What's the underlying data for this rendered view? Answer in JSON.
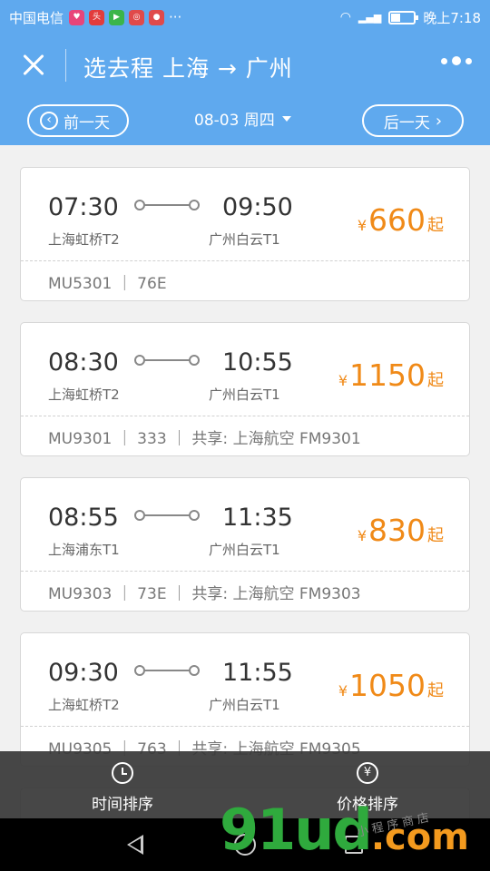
{
  "status_bar": {
    "carrier": "中国电信",
    "more": "···",
    "time": "晚上7:18"
  },
  "header": {
    "title": "选去程 上海 → 广州",
    "prev_day": "前一天",
    "next_day": "后一天",
    "date": "08-03 周四"
  },
  "flights": [
    {
      "dep_time": "07:30",
      "arr_time": "09:50",
      "dep_airport": "上海虹桥T2",
      "arr_airport": "广州白云T1",
      "currency": "¥",
      "price": "660",
      "price_suffix": "起",
      "info": "MU5301 ｜ 76E"
    },
    {
      "dep_time": "08:30",
      "arr_time": "10:55",
      "dep_airport": "上海虹桥T2",
      "arr_airport": "广州白云T1",
      "currency": "¥",
      "price": "1150",
      "price_suffix": "起",
      "info": "MU9301 ｜ 333 ｜ 共享: 上海航空 FM9301"
    },
    {
      "dep_time": "08:55",
      "arr_time": "11:35",
      "dep_airport": "上海浦东T1",
      "arr_airport": "广州白云T1",
      "currency": "¥",
      "price": "830",
      "price_suffix": "起",
      "info": "MU9303 ｜ 73E ｜ 共享: 上海航空 FM9303"
    },
    {
      "dep_time": "09:30",
      "arr_time": "11:55",
      "dep_airport": "上海虹桥T2",
      "arr_airport": "广州白云T1",
      "currency": "¥",
      "price": "1050",
      "price_suffix": "起",
      "info": "MU9305 ｜ 763 ｜ 共享: 上海航空 FM9305"
    }
  ],
  "sort_bar": {
    "time_sort": "时间排序",
    "price_sort": "价格排序"
  },
  "watermark": {
    "brand": "91ud",
    "domain": ".com",
    "sub": "小程序商店"
  },
  "colors": {
    "primary": "#5fa9ee",
    "price": "#f08a18"
  }
}
